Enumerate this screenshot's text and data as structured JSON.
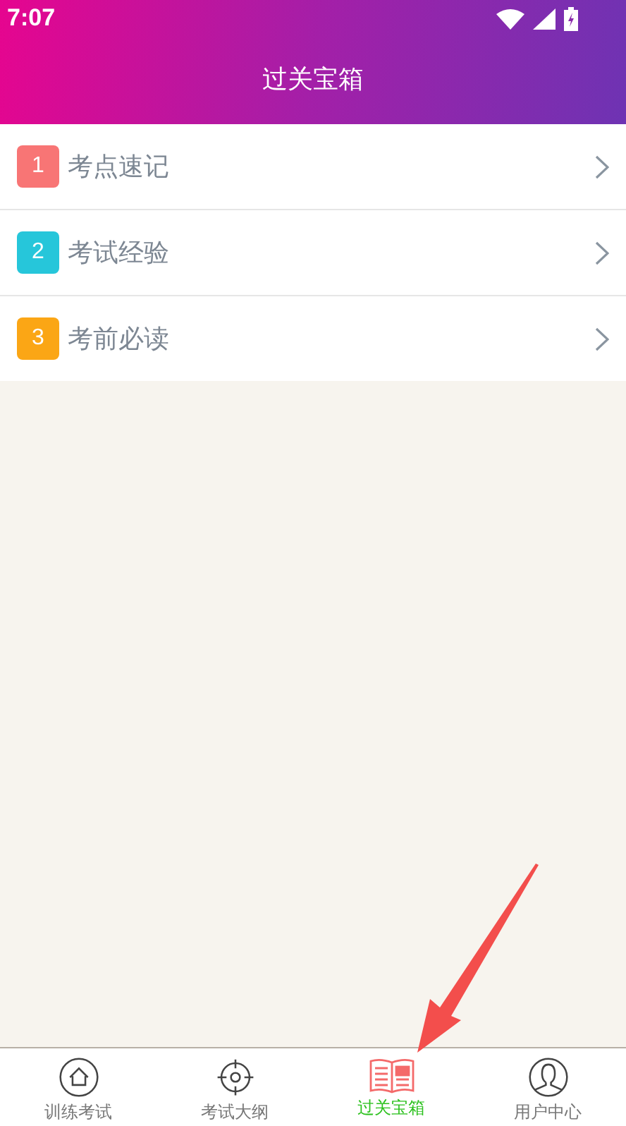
{
  "status_bar": {
    "time": "7:07"
  },
  "header": {
    "title": "过关宝箱"
  },
  "items": [
    {
      "number": "1",
      "label": "考点速记",
      "color": "#f87575"
    },
    {
      "number": "2",
      "label": "考试经验",
      "color": "#26c6da"
    },
    {
      "number": "3",
      "label": "考前必读",
      "color": "#fba615"
    }
  ],
  "tab_bar": [
    {
      "label": "训练考试",
      "selected": false
    },
    {
      "label": "考试大纲",
      "selected": false
    },
    {
      "label": "过关宝箱",
      "selected": true
    },
    {
      "label": "用户中心",
      "selected": false
    }
  ]
}
